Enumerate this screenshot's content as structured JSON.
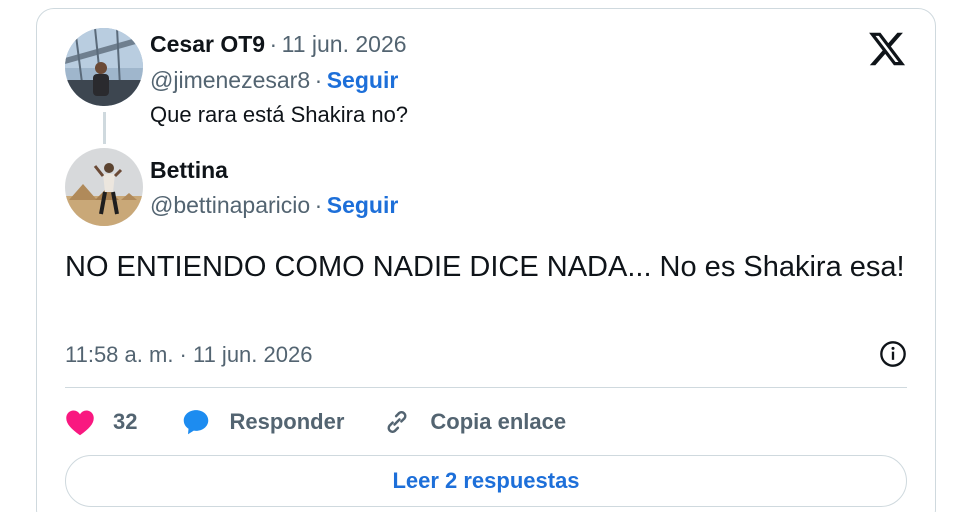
{
  "parent": {
    "name": "Cesar OT9",
    "separator": "·",
    "date": "11 jun. 2026",
    "handle": "@jimenezesar8",
    "follow_label": "Seguir",
    "text": "Que rara está Shakira no?"
  },
  "reply": {
    "name": "Bettina",
    "separator": "·",
    "handle": "@bettinaparicio",
    "follow_label": "Seguir",
    "text": "NO ENTIENDO COMO NADIE DICE NADA... No es Shakira esa!",
    "timestamp": "11:58 a. m. · 11 jun. 2026"
  },
  "actions": {
    "like_count": "32",
    "reply_label": "Responder",
    "copy_label": "Copia enlace"
  },
  "read_replies_label": "Leer 2 respuestas",
  "icons": {
    "logo": "x-logo-icon",
    "info": "info-icon",
    "like": "heart-icon",
    "reply": "speech-bubble-icon",
    "copy": "link-icon"
  },
  "colors": {
    "accent": "#1d6fd9",
    "like": "#f91880",
    "muted": "#536471",
    "border": "#cfd9de"
  }
}
